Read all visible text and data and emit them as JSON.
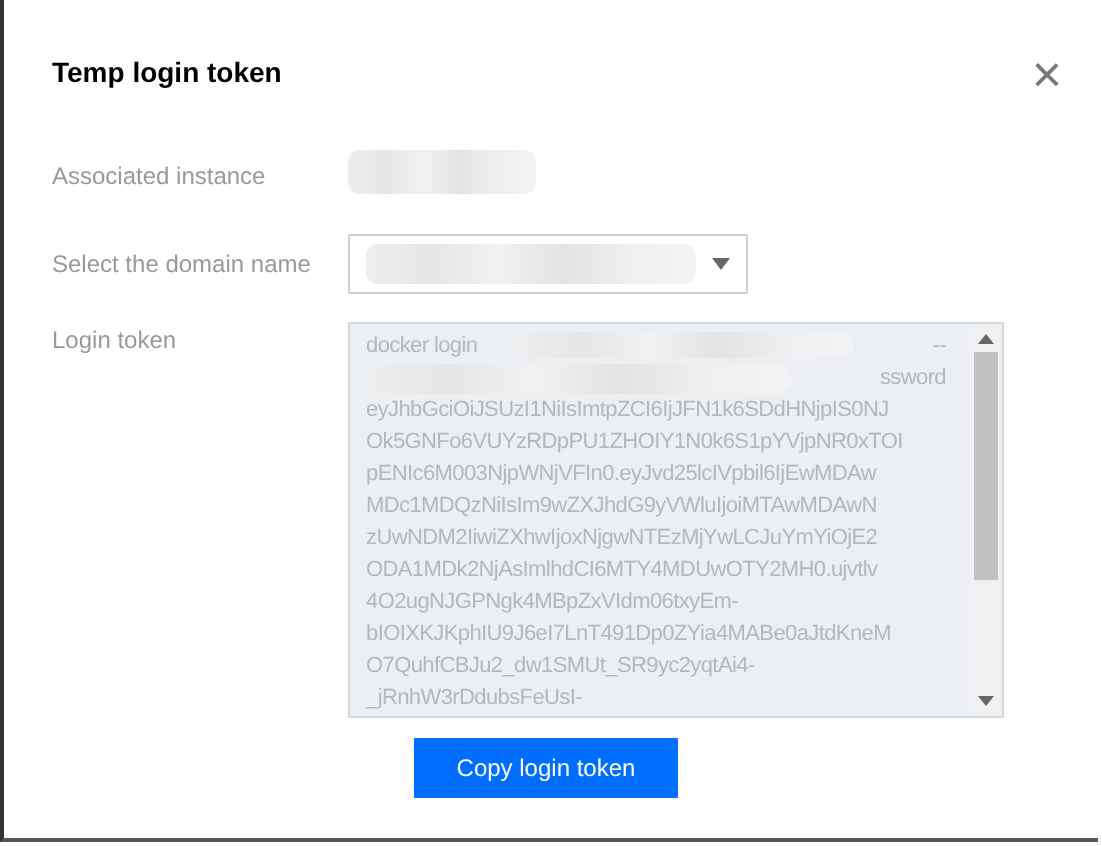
{
  "dialog": {
    "title": "Temp login token",
    "close": "×"
  },
  "fields": [
    {
      "label": "Associated instance",
      "kind": "redacted"
    },
    {
      "label": "Select the domain name",
      "kind": "select"
    },
    {
      "label": "Login token",
      "kind": "token"
    }
  ],
  "token": {
    "disabled": true,
    "lines": [
      {
        "left": "docker login",
        "right": "--"
      },
      {
        "right": "ssword"
      },
      {
        "left": "eyJhbGciOiJSUzI1NiIsImtpZCI6IjJFN1k6SDdHNjpIS0NJ"
      },
      {
        "left": "Ok5GNFo6VUYzRDpPU1ZHOIY1N0k6S1pYVjpNR0xTOI"
      },
      {
        "left": "pENIc6M003NjpWNjVFIn0.eyJvd25lcIVpbil6IjEwMDAw"
      },
      {
        "left": "MDc1MDQzNiIsIm9wZXJhdG9yVWluIjoiMTAwMDAwN"
      },
      {
        "left": "zUwNDM2IiwiZXhwIjoxNjgwNTEzMjYwLCJuYmYiOjE2"
      },
      {
        "left": "ODA1MDk2NjAsImlhdCI6MTY4MDUwOTY2MH0.ujvtlv"
      },
      {
        "left": "4O2ugNJGPNgk4MBpZxVIdm06txyEm-"
      },
      {
        "left": "bIOIXKJKphIU9J6eI7LnT491Dp0ZYia4MABe0aJtdKneM"
      },
      {
        "left": "O7QuhfCBJu2_dw1SMUt_SR9yc2yqtAi4-"
      },
      {
        "left": "_jRnhW3rDdubsFeUsI-"
      }
    ]
  },
  "button": "Copy login token"
}
